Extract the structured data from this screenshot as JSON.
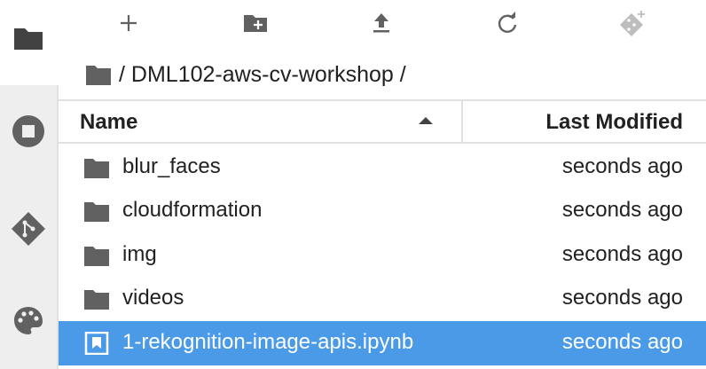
{
  "breadcrumb": {
    "separator_left": "/ ",
    "path": "DML102-aws-cv-workshop",
    "separator_right": " /"
  },
  "toolbar": {
    "buttons": [
      "new-launcher",
      "new-folder",
      "upload",
      "refresh",
      "git-clone"
    ]
  },
  "activity_bar": {
    "tabs": [
      "file-browser",
      "running-sessions",
      "git",
      "property-inspector"
    ]
  },
  "listing": {
    "headers": {
      "name": "Name",
      "last_modified": "Last Modified"
    },
    "sort": "name-ascending",
    "items": [
      {
        "name": "blur_faces",
        "type": "folder",
        "modified": "seconds ago"
      },
      {
        "name": "cloudformation",
        "type": "folder",
        "modified": "seconds ago"
      },
      {
        "name": "img",
        "type": "folder",
        "modified": "seconds ago"
      },
      {
        "name": "videos",
        "type": "folder",
        "modified": "seconds ago"
      },
      {
        "name": "1-rekognition-image-apis.ipynb",
        "type": "notebook",
        "modified": "seconds ago",
        "selected": true
      }
    ]
  },
  "colors": {
    "selection": "#4a9ae8",
    "icon": "#616161",
    "activity_bg": "#eeeeee"
  }
}
